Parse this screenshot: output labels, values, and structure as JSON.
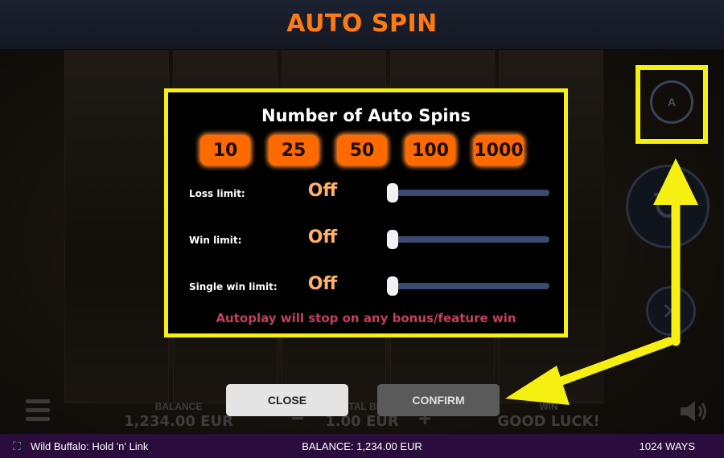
{
  "header": {
    "title": "AUTO SPIN"
  },
  "modal": {
    "title": "Number of Auto Spins",
    "spin_options": [
      "10",
      "25",
      "50",
      "100",
      "1000"
    ],
    "limits": [
      {
        "label": "Loss limit:",
        "value": "Off",
        "slider_fraction": 0
      },
      {
        "label": "Win limit:",
        "value": "Off",
        "slider_fraction": 0
      },
      {
        "label": "Single win limit:",
        "value": "Off",
        "slider_fraction": 0
      }
    ],
    "note": "Autoplay will stop on any bonus/feature win"
  },
  "buttons": {
    "close": "CLOSE",
    "confirm": "CONFIRM"
  },
  "hud": {
    "balance_label": "BALANCE",
    "balance_value": "1,234.00 EUR",
    "total_bet_label": "TOTAL BET",
    "total_bet_value": "1.00 EUR",
    "win_label": "WIN",
    "win_value": "GOOD LUCK!"
  },
  "status_bar": {
    "game_name": "Wild Buffalo: Hold 'n' Link",
    "balance": "BALANCE: 1,234.00 EUR",
    "ways": "1024 WAYS"
  },
  "icons": {
    "autoplay": "autoplay-icon",
    "spin": "spin-icon",
    "stop": "stop-icon",
    "menu": "menu-icon",
    "sound": "speaker-icon",
    "fullscreen": "fullscreen-icon"
  },
  "colors": {
    "title": "#ff7a12",
    "highlight": "#f5ef12",
    "spin_option": "#ff6a00",
    "limit_value": "#ffb06a",
    "note": "#c2405f",
    "status_bar": "#2a0d3c"
  }
}
